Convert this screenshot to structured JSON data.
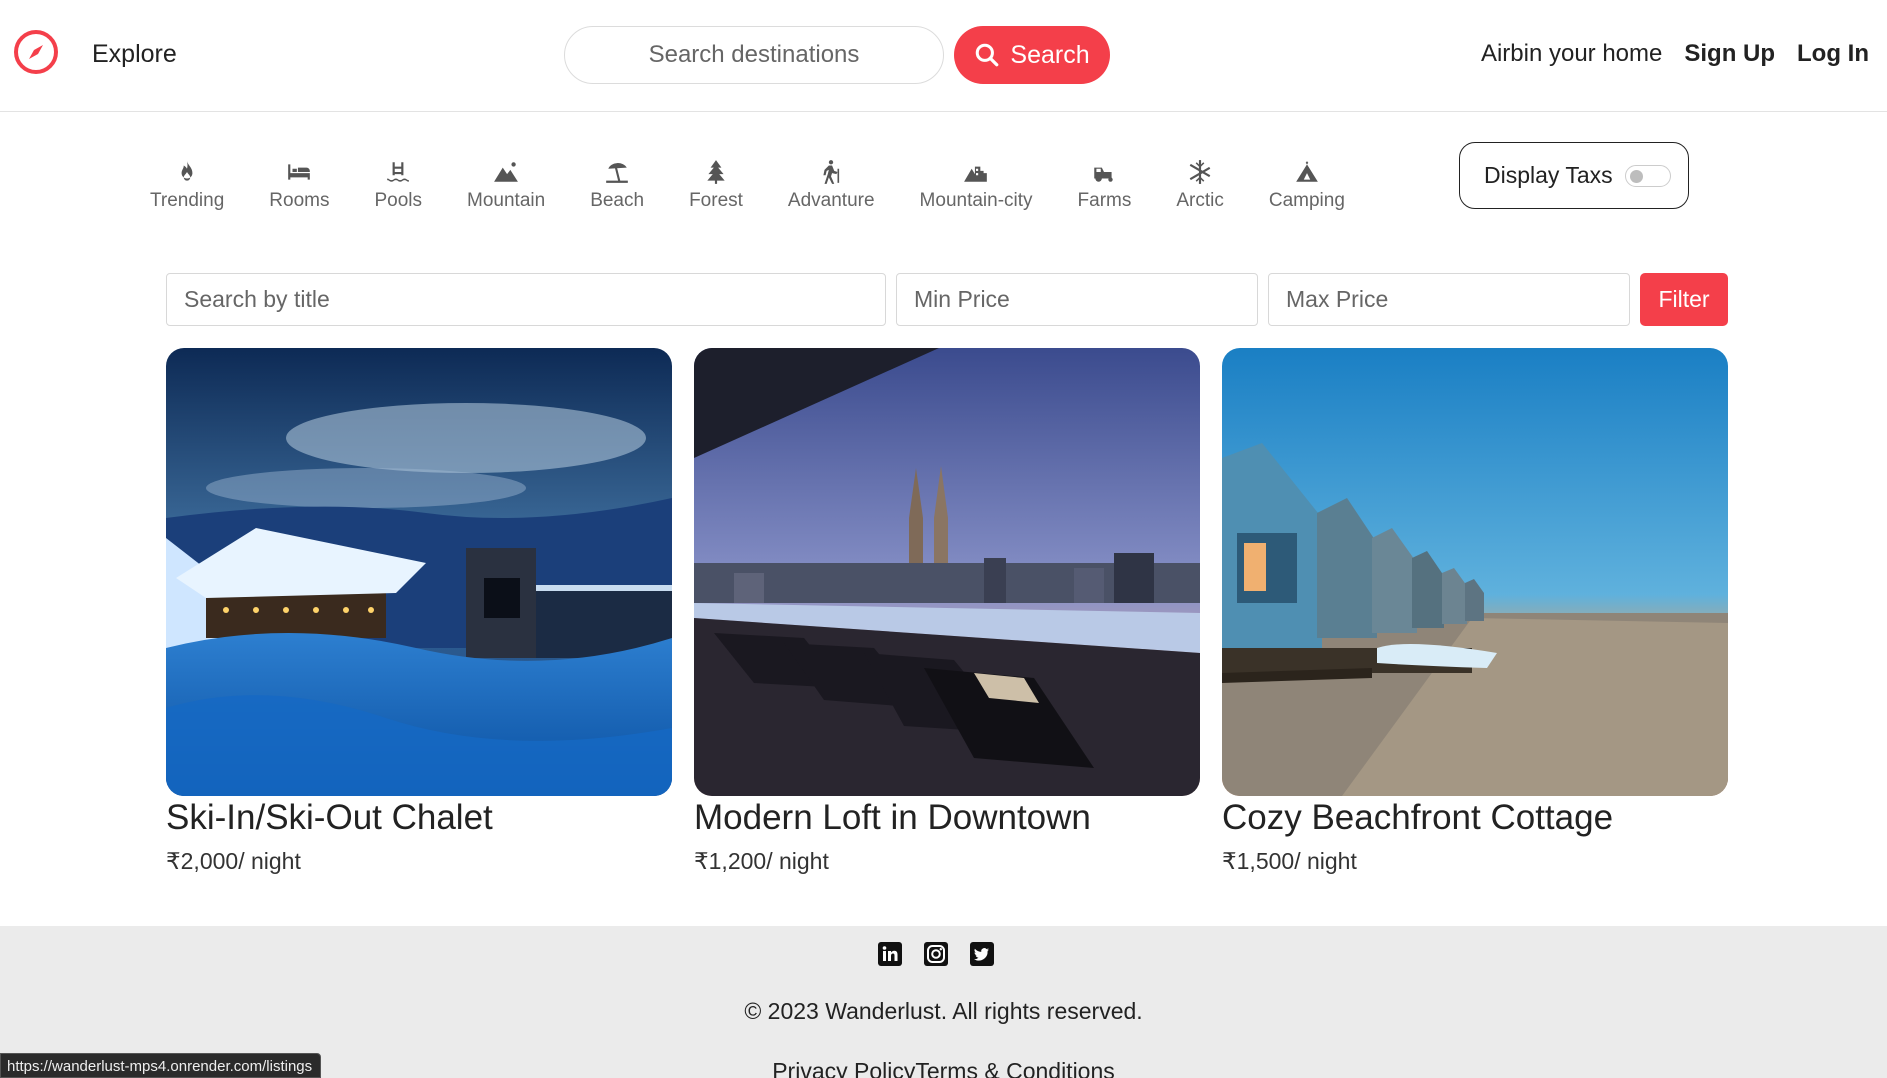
{
  "navbar": {
    "brand_icon": "compass-icon",
    "explore": "Explore",
    "search_placeholder": "Search destinations",
    "search_button": "Search",
    "host_link": "Airbin your home",
    "signup": "Sign Up",
    "login": "Log In",
    "accent_color": "#f43f4a"
  },
  "categories": [
    {
      "label": "Trending",
      "icon": "fire-icon"
    },
    {
      "label": "Rooms",
      "icon": "bed-icon"
    },
    {
      "label": "Pools",
      "icon": "pool-icon"
    },
    {
      "label": "Mountain",
      "icon": "mountain-icon"
    },
    {
      "label": "Beach",
      "icon": "umbrella-beach-icon"
    },
    {
      "label": "Forest",
      "icon": "tree-icon"
    },
    {
      "label": "Advanture",
      "icon": "hiking-icon"
    },
    {
      "label": "Mountain-city",
      "icon": "mountain-city-icon"
    },
    {
      "label": "Farms",
      "icon": "tractor-icon"
    },
    {
      "label": "Arctic",
      "icon": "snowflake-icon"
    },
    {
      "label": "Camping",
      "icon": "tent-icon"
    }
  ],
  "tax_toggle": {
    "label": "Display Taxs",
    "enabled": false
  },
  "filter_row": {
    "title_placeholder": "Search by title",
    "min_placeholder": "Min Price",
    "max_placeholder": "Max Price",
    "button": "Filter"
  },
  "listings": [
    {
      "title": "Ski-In/Ski-Out Chalet",
      "price": "₹2,000",
      "per": "/ night",
      "image": "snowy-chalet-photo"
    },
    {
      "title": "Modern Loft in Downtown",
      "price": "₹1,200",
      "per": "/ night",
      "image": "city-rooftop-pool-photo"
    },
    {
      "title": "Cozy Beachfront Cottage",
      "price": "₹1,500",
      "per": "/ night",
      "image": "beach-huts-photo"
    }
  ],
  "footer": {
    "socials": [
      "linkedin-icon",
      "instagram-icon",
      "twitter-icon"
    ],
    "copyright": "© 2023 Wanderlust. All rights reserved.",
    "links": [
      "Privacy Policy",
      "Terms & Conditions"
    ]
  },
  "status_bar": {
    "url": "https://wanderlust-mps4.onrender.com/listings"
  }
}
